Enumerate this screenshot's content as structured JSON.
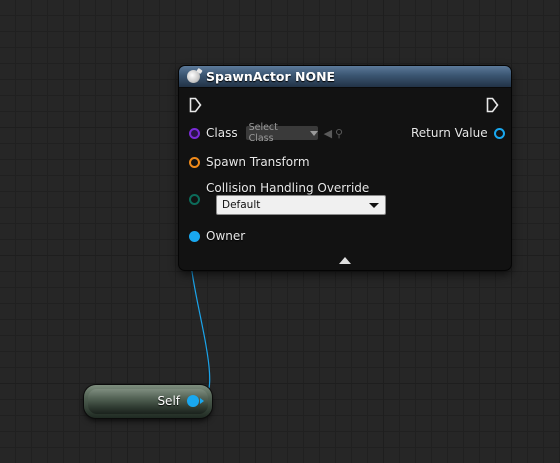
{
  "node": {
    "title": "SpawnActor NONE",
    "pins": {
      "class_label": "Class",
      "class_select_placeholder": "Select Class",
      "spawn_transform_label": "Spawn Transform",
      "collision_label": "Collision Handling Override",
      "collision_value": "Default",
      "owner_label": "Owner",
      "return_value_label": "Return Value"
    }
  },
  "self_node": {
    "label": "Self"
  },
  "colors": {
    "header": "#3a5571",
    "class_pin": "#7a2bd6",
    "transform_pin": "#f08a1a",
    "enum_pin": "#0c6b5a",
    "object_pin": "#19a8f0",
    "wire": "#19a8f0"
  },
  "icons": [
    "function-icon",
    "exec-pin-icon",
    "browse-icon",
    "search-icon",
    "expand-arrow-icon"
  ]
}
